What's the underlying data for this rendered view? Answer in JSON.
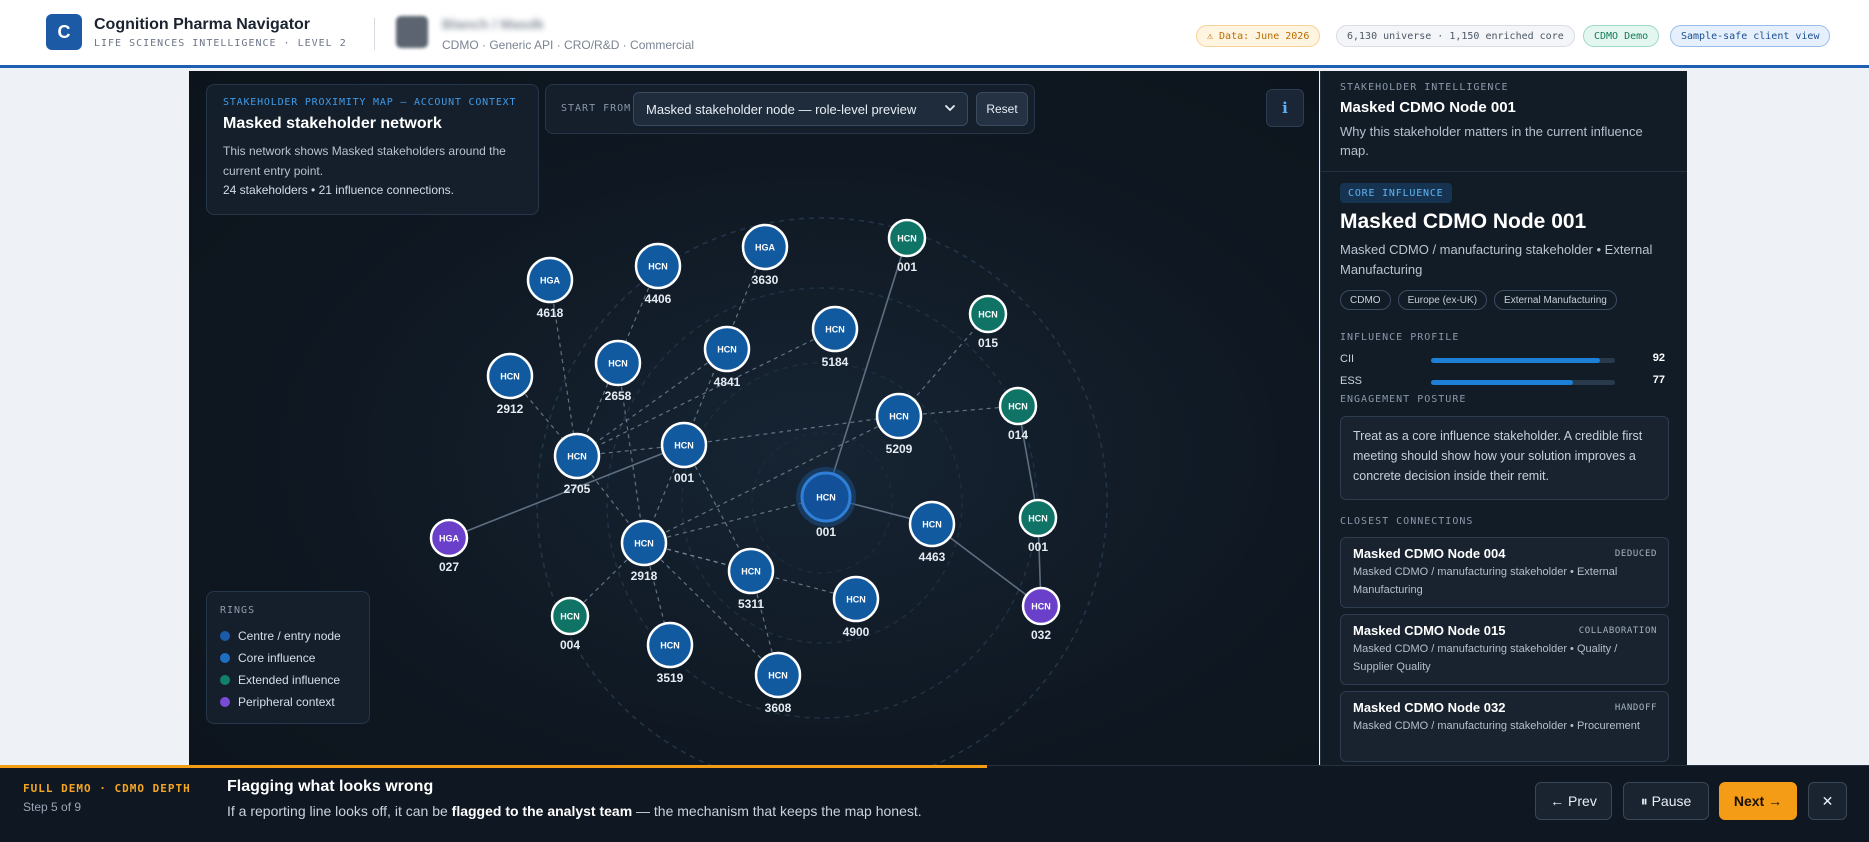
{
  "header": {
    "logo_letter": "C",
    "title": "Cognition Pharma Navigator",
    "subtitle": "LIFE SCIENCES INTELLIGENCE · LEVEL 2",
    "client_name": "Blanch / Masdk",
    "client_sub": "CDMO · Generic API · CRO/R&D · Commercial",
    "pill_data": "⚠ Data: June 2026",
    "pill_universe": "6,130 universe · 1,150 enriched core",
    "pill_demo": "CDMO Demo",
    "pill_safe": "Sample-safe client view"
  },
  "info_card": {
    "eyebrow": "STAKEHOLDER PROXIMITY MAP — ACCOUNT CONTEXT",
    "title": "Masked stakeholder network",
    "body": "This network shows Masked stakeholders around the current entry point.",
    "count": "24 stakeholders • 21 influence connections."
  },
  "start": {
    "label": "START FROM",
    "selected": "Masked stakeholder node — role-level preview",
    "reset": "Reset"
  },
  "info_button": "i",
  "legend": {
    "title": "RINGS",
    "items": [
      {
        "label": "Centre / entry node",
        "color": "#1a5aa8"
      },
      {
        "label": "Core influence",
        "color": "#1d6fc4"
      },
      {
        "label": "Extended influence",
        "color": "#13806c"
      },
      {
        "label": "Peripheral context",
        "color": "#7a4bd6"
      }
    ]
  },
  "colors": {
    "centre": "#12509a",
    "core": "#125aa0",
    "extended": "#0f7466",
    "peripheral": "#6a3fc9"
  },
  "network": {
    "nodes": [
      {
        "id": "n0",
        "abbr": "HCN",
        "label": "001",
        "ring": "centre"
      },
      {
        "id": "n1",
        "abbr": "HGA",
        "label": "4618",
        "ring": "core"
      },
      {
        "id": "n2",
        "abbr": "HCN",
        "label": "4406",
        "ring": "core"
      },
      {
        "id": "n3",
        "abbr": "HGA",
        "label": "3630",
        "ring": "core"
      },
      {
        "id": "n4",
        "abbr": "HCN",
        "label": "001",
        "ring": "extended"
      },
      {
        "id": "n5",
        "abbr": "HCN",
        "label": "015",
        "ring": "extended"
      },
      {
        "id": "n6",
        "abbr": "HCN",
        "label": "2912",
        "ring": "core"
      },
      {
        "id": "n7",
        "abbr": "HCN",
        "label": "2658",
        "ring": "core"
      },
      {
        "id": "n8",
        "abbr": "HCN",
        "label": "4841",
        "ring": "core"
      },
      {
        "id": "n9",
        "abbr": "HCN",
        "label": "5184",
        "ring": "core"
      },
      {
        "id": "n10",
        "abbr": "HCN",
        "label": "014",
        "ring": "extended"
      },
      {
        "id": "n11",
        "abbr": "HCN",
        "label": "5209",
        "ring": "core"
      },
      {
        "id": "n12",
        "abbr": "HCN",
        "label": "2705",
        "ring": "core"
      },
      {
        "id": "n13",
        "abbr": "HCN",
        "label": "001",
        "ring": "core"
      },
      {
        "id": "n14",
        "abbr": "HGA",
        "label": "027",
        "ring": "peripheral"
      },
      {
        "id": "n15",
        "abbr": "HCN",
        "label": "2918",
        "ring": "core"
      },
      {
        "id": "n16",
        "abbr": "HCN",
        "label": "4463",
        "ring": "core"
      },
      {
        "id": "n17",
        "abbr": "HCN",
        "label": "001",
        "ring": "extended"
      },
      {
        "id": "n18",
        "abbr": "HCN",
        "label": "5311",
        "ring": "core"
      },
      {
        "id": "n19",
        "abbr": "HCN",
        "label": "4900",
        "ring": "core"
      },
      {
        "id": "n20",
        "abbr": "HCN",
        "label": "004",
        "ring": "extended"
      },
      {
        "id": "n21",
        "abbr": "HCN",
        "label": "3519",
        "ring": "core"
      },
      {
        "id": "n22",
        "abbr": "HCN",
        "label": "3608",
        "ring": "core"
      },
      {
        "id": "n23",
        "abbr": "HCN",
        "label": "032",
        "ring": "peripheral"
      }
    ],
    "edges": [
      [
        "n0",
        "n4",
        "solid"
      ],
      [
        "n0",
        "n16",
        "solid"
      ],
      [
        "n13",
        "n14",
        "solid"
      ],
      [
        "n16",
        "n23",
        "solid"
      ],
      [
        "n10",
        "n17",
        "solid"
      ],
      [
        "n17",
        "n23",
        "solid"
      ],
      [
        "n1",
        "n12",
        "dashed"
      ],
      [
        "n2",
        "n12",
        "dashed"
      ],
      [
        "n3",
        "n15",
        "dashed"
      ],
      [
        "n6",
        "n12",
        "dashed"
      ],
      [
        "n7",
        "n15",
        "dashed"
      ],
      [
        "n8",
        "n12",
        "dashed"
      ],
      [
        "n9",
        "n12",
        "dashed"
      ],
      [
        "n5",
        "n11",
        "dashed"
      ],
      [
        "n11",
        "n10",
        "dashed"
      ],
      [
        "n13",
        "n11",
        "dashed"
      ],
      [
        "n12",
        "n15",
        "dashed"
      ],
      [
        "n12",
        "n13",
        "dashed"
      ],
      [
        "n15",
        "n0",
        "dashed"
      ],
      [
        "n15",
        "n18",
        "dashed"
      ],
      [
        "n15",
        "n19",
        "dashed"
      ],
      [
        "n15",
        "n20",
        "dashed"
      ],
      [
        "n15",
        "n21",
        "dashed"
      ],
      [
        "n15",
        "n22",
        "dashed"
      ],
      [
        "n11",
        "n15",
        "dashed"
      ],
      [
        "n18",
        "n22",
        "dashed"
      ],
      [
        "n13",
        "n18",
        "dashed"
      ]
    ]
  },
  "panel": {
    "eyebrow": "STAKEHOLDER INTELLIGENCE",
    "head": "Masked CDMO Node 001",
    "why": "Why this stakeholder matters in the current influence map.",
    "badge": "CORE INFLUENCE",
    "name": "Masked CDMO Node 001",
    "role": "Masked CDMO / manufacturing stakeholder • External Manufacturing",
    "tags": [
      "CDMO",
      "Europe (ex-UK)",
      "External Manufacturing"
    ],
    "profile_title": "INFLUENCE PROFILE",
    "metrics": [
      {
        "label": "CII",
        "value": 92
      },
      {
        "label": "ESS",
        "value": 77
      }
    ],
    "posture_title": "ENGAGEMENT POSTURE",
    "posture": "Treat as a core influence stakeholder. A credible first meeting should show how your solution improves a concrete decision inside their remit.",
    "connections_title": "CLOSEST CONNECTIONS",
    "connections": [
      {
        "name": "Masked CDMO Node 004",
        "type": "DEDUCED",
        "desc": "Masked CDMO / manufacturing stakeholder • External Manufacturing"
      },
      {
        "name": "Masked CDMO Node 015",
        "type": "COLLABORATION",
        "desc": "Masked CDMO / manufacturing stakeholder • Quality / Supplier Quality"
      },
      {
        "name": "Masked CDMO Node 032",
        "type": "HANDOFF",
        "desc": "Masked CDMO / manufacturing stakeholder • Procurement"
      }
    ]
  },
  "tour": {
    "eyebrow": "FULL DEMO · CDMO DEPTH",
    "step": "Step 5 of 9",
    "progress_pct": 52.8,
    "title": "Flagging what looks wrong",
    "text_before": "If a reporting line looks off, it can be ",
    "text_bold": "flagged to the analyst team",
    "text_after": " — the mechanism that keeps the map honest.",
    "prev": "← Prev",
    "pause": "⏸ Pause",
    "next": "Next →",
    "close": "✕"
  }
}
